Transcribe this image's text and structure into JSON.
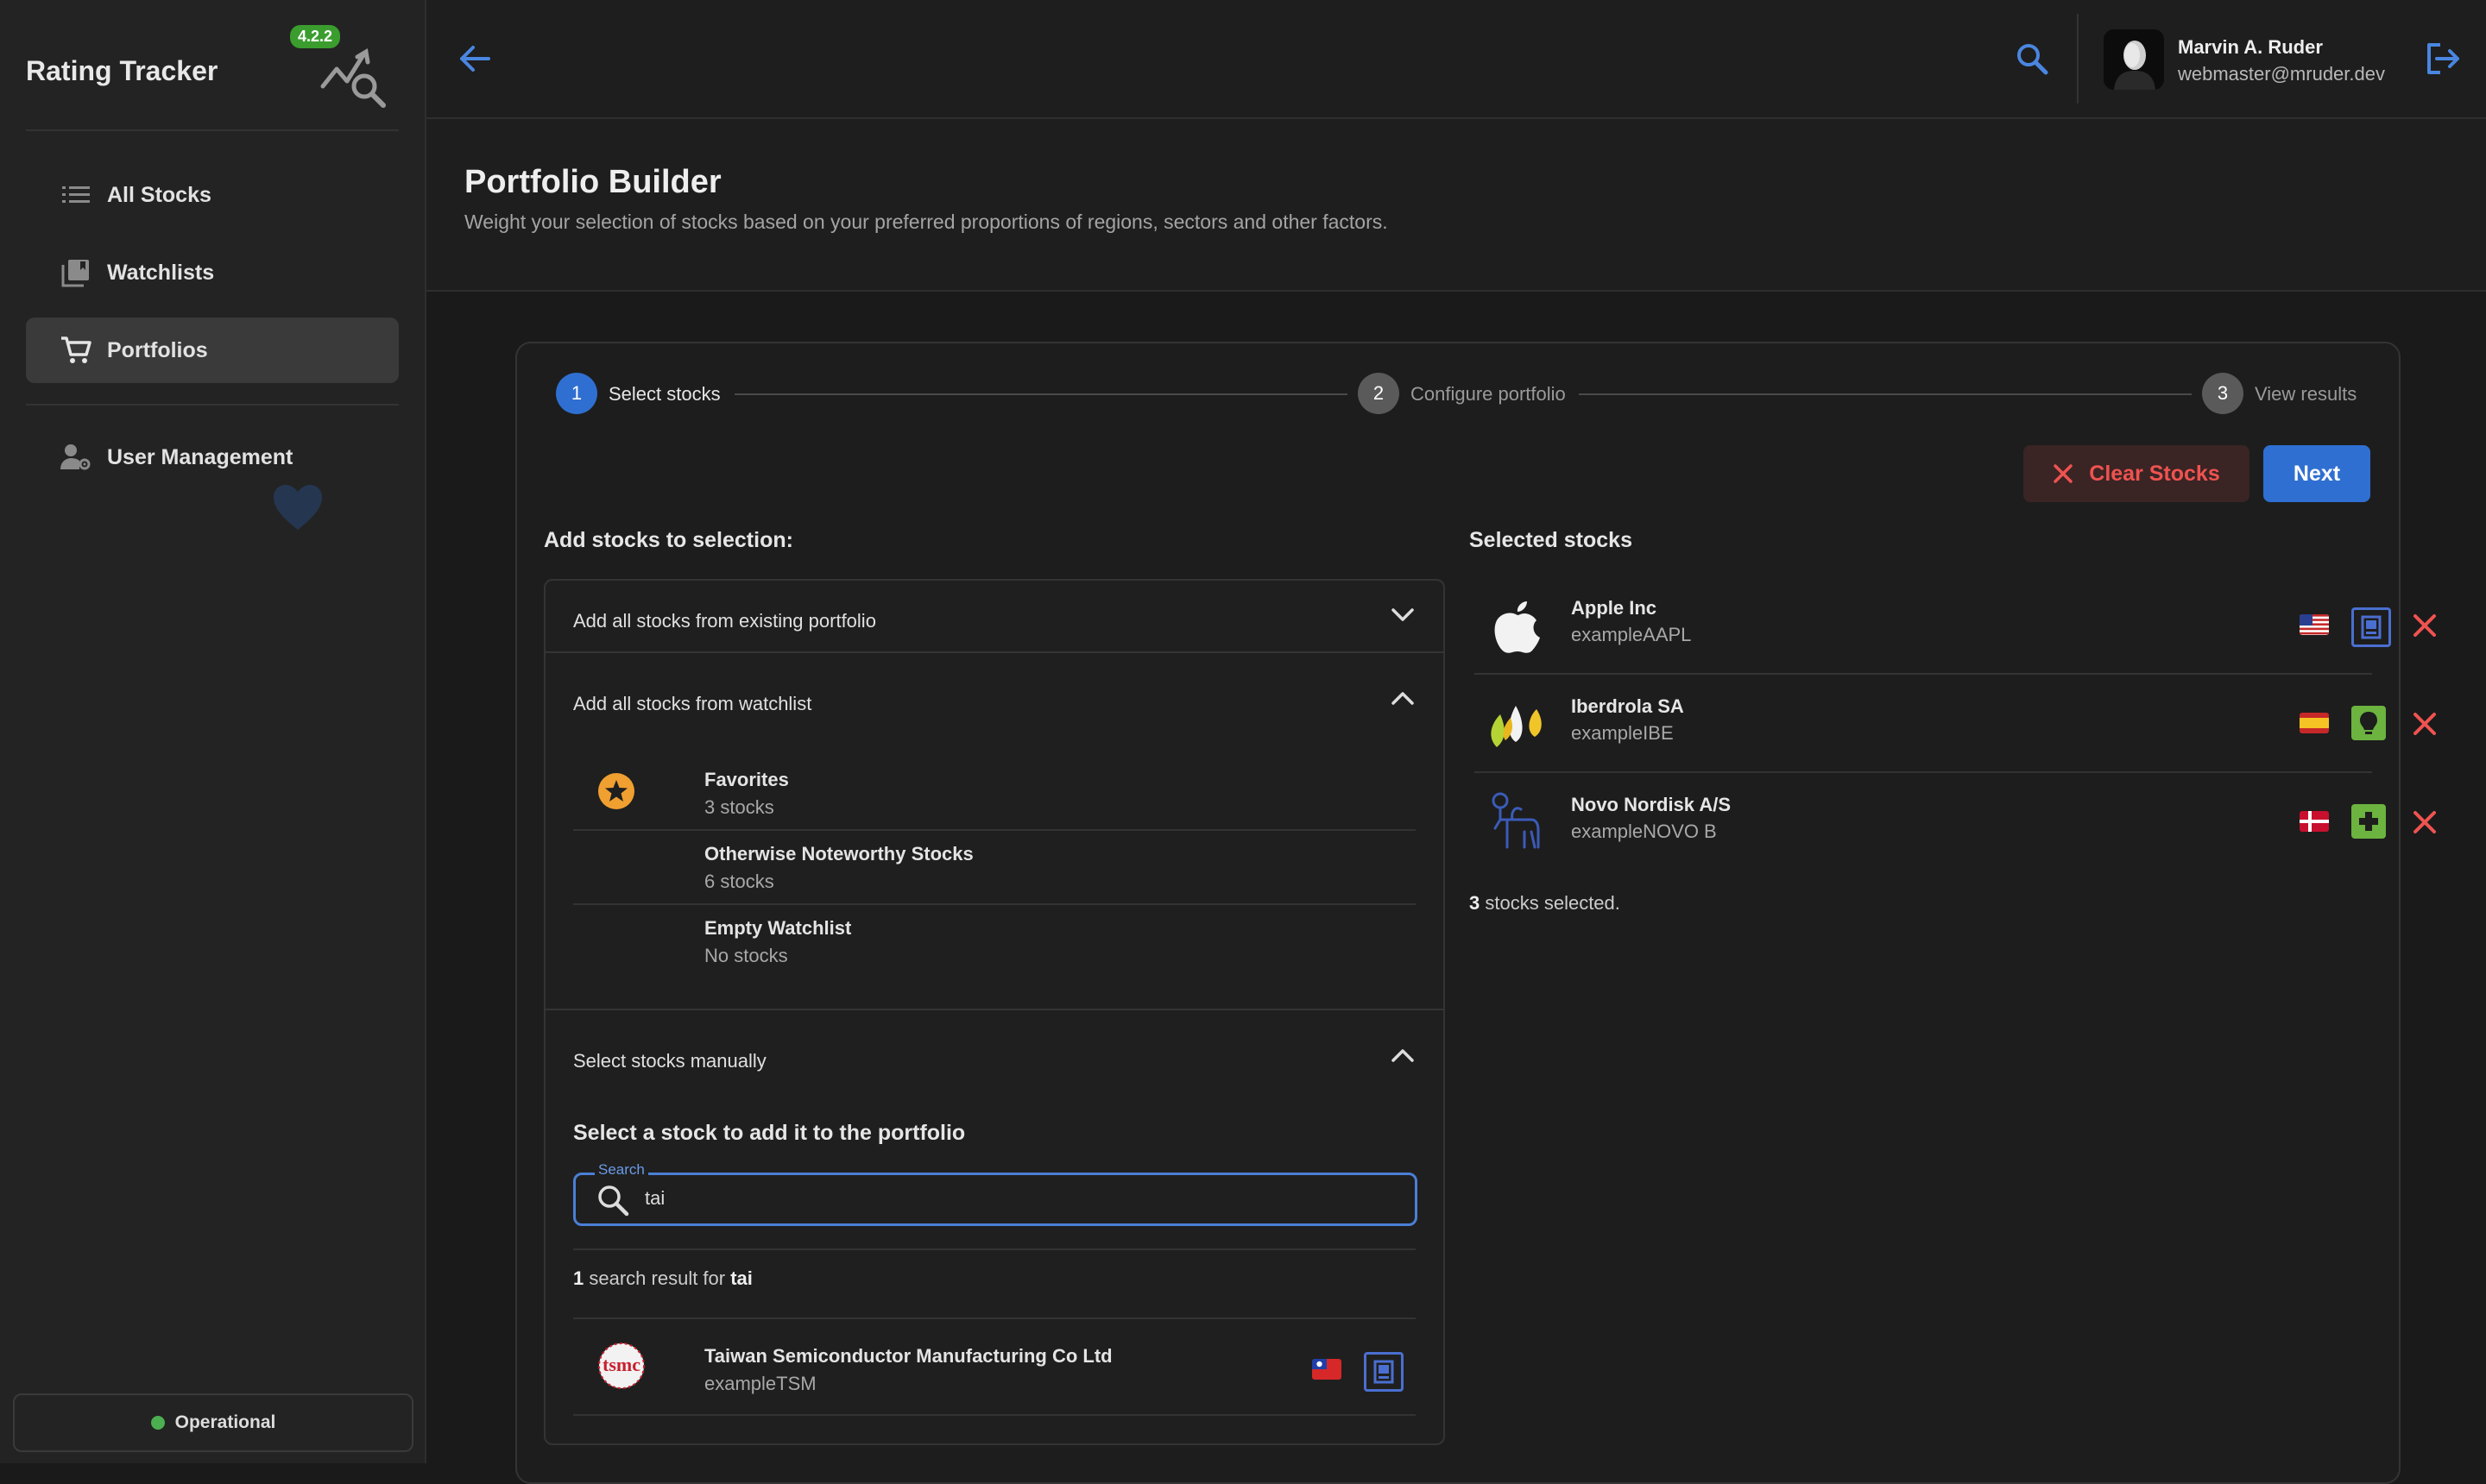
{
  "app": {
    "title": "Rating Tracker",
    "version": "4.2.2"
  },
  "sidebar": {
    "items": [
      {
        "label": "All Stocks",
        "icon": "list-icon"
      },
      {
        "label": "Watchlists",
        "icon": "watchlists-icon"
      },
      {
        "label": "Portfolios",
        "icon": "cart-icon",
        "active": true
      },
      {
        "label": "User Management",
        "icon": "user-gear-icon"
      }
    ],
    "status": "Operational"
  },
  "header": {
    "user_name": "Marvin A. Ruder",
    "user_email": "webmaster@mruder.dev"
  },
  "page": {
    "title": "Portfolio Builder",
    "subtitle": "Weight your selection of stocks based on your preferred proportions of regions, sectors and other factors."
  },
  "stepper": [
    {
      "num": "1",
      "label": "Select stocks",
      "active": true
    },
    {
      "num": "2",
      "label": "Configure portfolio",
      "active": false
    },
    {
      "num": "3",
      "label": "View results",
      "active": false
    }
  ],
  "actions": {
    "clear": "Clear Stocks",
    "next": "Next"
  },
  "add_section": {
    "title": "Add stocks to selection:",
    "from_portfolio": "Add all stocks from existing portfolio",
    "from_watchlist": "Add all stocks from watchlist",
    "watchlists": [
      {
        "name": "Favorites",
        "count": "3 stocks"
      },
      {
        "name": "Otherwise Noteworthy Stocks",
        "count": "6 stocks"
      },
      {
        "name": "Empty Watchlist",
        "count": "No stocks"
      }
    ],
    "manual": "Select stocks manually",
    "manual_title": "Select a stock to add it to the portfolio",
    "search_label": "Search",
    "search_value": "tai",
    "result_count": "1",
    "result_text": "search result for",
    "result_query": "tai",
    "results": [
      {
        "name": "Taiwan Semiconductor Manufacturing Co Ltd",
        "ticker": "exampleTSM"
      }
    ]
  },
  "selected": {
    "title": "Selected stocks",
    "stocks": [
      {
        "name": "Apple Inc",
        "ticker": "exampleAAPL"
      },
      {
        "name": "Iberdrola SA",
        "ticker": "exampleIBE"
      },
      {
        "name": "Novo Nordisk A/S",
        "ticker": "exampleNOVO B"
      }
    ],
    "count": "3",
    "count_text": "stocks selected."
  },
  "colors": {
    "accent": "#2f6fd1",
    "danger": "#ef5350",
    "success": "#3a9d2e",
    "tech": "#4a6fd0",
    "utilities": "#6cb33f"
  }
}
